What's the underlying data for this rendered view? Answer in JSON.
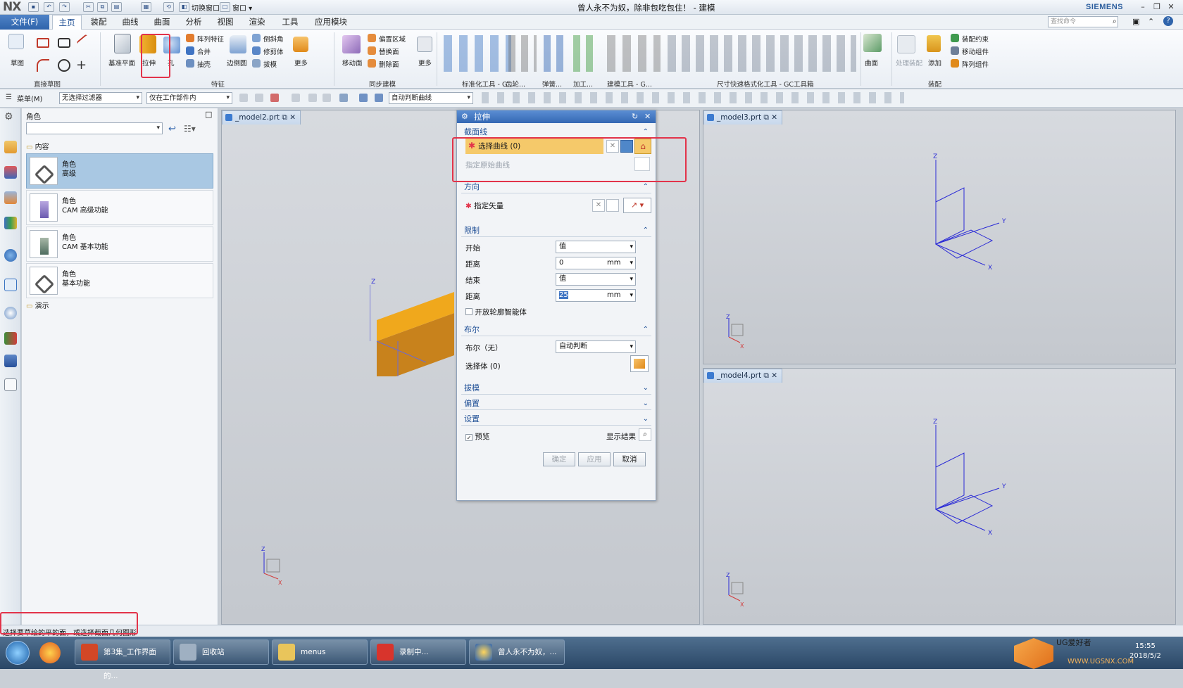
{
  "app": {
    "logo": "NX",
    "title": "曾人永不为奴，除非包吃包住！ - 建模",
    "brand": "SIEMENS",
    "switch_window": "切换窗口",
    "window_menu": "窗口"
  },
  "tabs": {
    "file": "文件(F)",
    "items": [
      "主页",
      "装配",
      "曲线",
      "曲面",
      "分析",
      "视图",
      "渲染",
      "工具",
      "应用模块"
    ],
    "active": "主页"
  },
  "search": {
    "placeholder": "查找命令"
  },
  "ribbon": {
    "sketch": "草图",
    "direct_sketch": "直接草图",
    "datum_plane": "基准平面",
    "extrude": "拉伸",
    "hole": "孔",
    "pattern_feature": "阵列特征",
    "unite": "合并",
    "shell": "抽壳",
    "edge_blend": "边倒圆",
    "chamfer": "倒斜角",
    "trim_body": "修剪体",
    "draft": "拔模",
    "more": "更多",
    "feature": "特征",
    "move_face": "移动面",
    "offset_region": "偏置区域",
    "replace_face": "替换面",
    "delete_face": "删除面",
    "sync_modeling": "同步建模",
    "std_tools": "标准化工具 - G...",
    "gear": "齿轮...",
    "spring": "弹簧...",
    "machining": "加工...",
    "modeling_tools": "建模工具 - G...",
    "dim_tools": "尺寸快速格式化工具 - GC工具箱",
    "surface": "曲面",
    "add": "添加",
    "assembly_constraint": "装配约束",
    "move_component": "移动组件",
    "pattern_component": "阵列组件",
    "assembly": "装配",
    "wave": "处理装配"
  },
  "selection_bar": {
    "menu": "菜单(M)",
    "filter": "无选择过滤器",
    "scope": "仅在工作部件内",
    "curve_rule": "自动判断曲线"
  },
  "role_panel": {
    "title": "角色",
    "content_folder": "内容",
    "demo_folder": "演示",
    "items": [
      {
        "name": "角色",
        "desc": "高级"
      },
      {
        "name": "角色",
        "desc": "CAM 高级功能"
      },
      {
        "name": "角色",
        "desc": "CAM 基本功能"
      },
      {
        "name": "角色",
        "desc": "基本功能"
      }
    ]
  },
  "viewports": {
    "v2": "_model2.prt",
    "v3": "_model3.prt",
    "v4": "_model4.prt"
  },
  "dialog": {
    "title": "拉伸",
    "section_curve": "截面线",
    "select_curve": "选择曲线 (0)",
    "specify_origin_curve": "指定原始曲线",
    "direction": "方向",
    "specify_vector": "指定矢量",
    "limits": "限制",
    "start": "开始",
    "start_type": "值",
    "distance": "距离",
    "start_distance": "0",
    "unit": "mm",
    "end": "结束",
    "end_type": "值",
    "end_distance": "25",
    "open_profile": "开放轮廓智能体",
    "boolean": "布尔",
    "boolean_label": "布尔（无）",
    "boolean_value": "自动判断",
    "select_body": "选择体 (0)",
    "draft": "拔模",
    "offset": "偏置",
    "settings": "设置",
    "preview": "预览",
    "show_result": "显示结果",
    "ok": "确定",
    "apply": "应用",
    "cancel": "取消"
  },
  "status": {
    "text": "选择要草绘的平的面，或选择截面几何图形"
  },
  "taskbar": {
    "items": [
      "第3集_工作界面的...",
      "回收站",
      "menus",
      "录制中...",
      "曾人永不为奴，..."
    ],
    "time": "15:55",
    "date": "2018/5/2",
    "watermark": "UG爱好者",
    "watermark_url": "WWW.UGSNX.COM"
  },
  "colors": {
    "accent": "#2f64ab",
    "highlight": "#f5c96a",
    "red_box": "#e2334a",
    "solid": "#f0a81c"
  }
}
